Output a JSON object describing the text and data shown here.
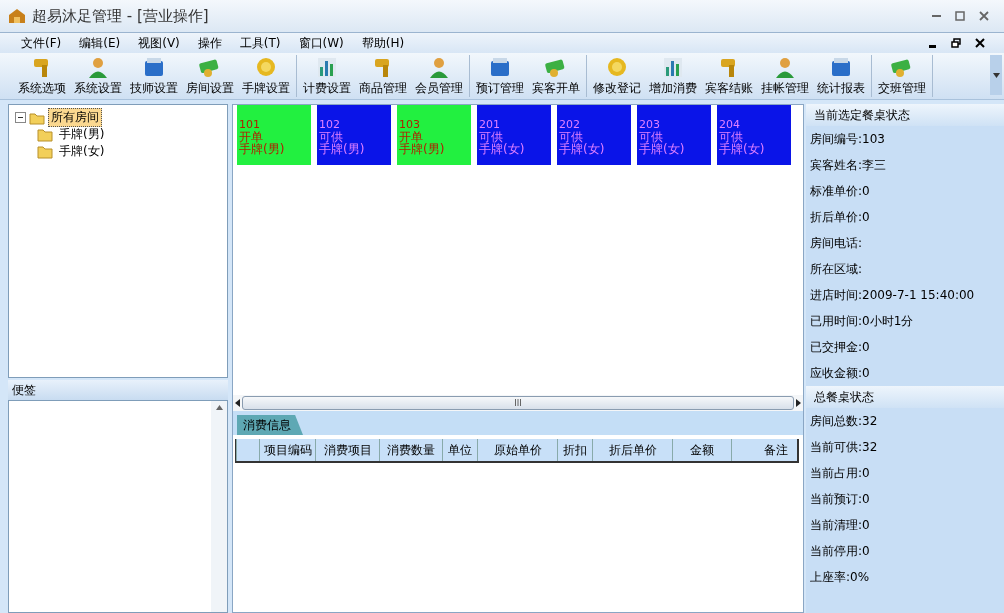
{
  "window": {
    "title": "超易沐足管理 - [营业操作]"
  },
  "menu": [
    "文件(F)",
    "编辑(E)",
    "视图(V)",
    "操作",
    "工具(T)",
    "窗口(W)",
    "帮助(H)"
  ],
  "toolbar_groups": [
    {
      "buttons": [
        "系统选项",
        "系统设置",
        "技师设置",
        "房间设置",
        "手牌设置"
      ]
    },
    {
      "buttons": [
        "计费设置",
        "商品管理",
        "会员管理"
      ]
    },
    {
      "buttons": [
        "预订管理",
        "宾客开单"
      ]
    },
    {
      "buttons": [
        "修改登记",
        "增加消费",
        "宾客结账",
        "挂帐管理",
        "统计报表"
      ]
    },
    {
      "buttons": [
        "交班管理"
      ]
    }
  ],
  "tree": [
    {
      "label": "所有房间",
      "selected": true,
      "expanded": true,
      "children": [
        {
          "label": "手牌(男)",
          "selected": false
        },
        {
          "label": "手牌(女)",
          "selected": false
        }
      ]
    }
  ],
  "notes": {
    "title": "便签"
  },
  "rooms": [
    {
      "number": "101",
      "status": "开单",
      "tag": "手牌(男)",
      "kind": "open"
    },
    {
      "number": "102",
      "status": "可供",
      "tag": "手牌(男)",
      "kind": "available"
    },
    {
      "number": "103",
      "status": "开单",
      "tag": "手牌(男)",
      "kind": "open"
    },
    {
      "number": "201",
      "status": "可供",
      "tag": "手牌(女)",
      "kind": "available"
    },
    {
      "number": "202",
      "status": "可供",
      "tag": "手牌(女)",
      "kind": "available"
    },
    {
      "number": "203",
      "status": "可供",
      "tag": "手牌(女)",
      "kind": "available"
    },
    {
      "number": "204",
      "status": "可供",
      "tag": "手牌(女)",
      "kind": "available"
    }
  ],
  "tabs": [
    {
      "label": "消费信息",
      "selected": true
    }
  ],
  "table": {
    "columns": [
      "项目编码",
      "消费项目",
      "消费数量",
      "单位",
      "原始单价",
      "折扣",
      "折后单价",
      "金额",
      "备注"
    ]
  },
  "info_sections": [
    {
      "title": "当前选定餐桌状态",
      "rows": [
        "房间编号:103",
        "宾客姓名:李三",
        "标准单价:0",
        "折后单价:0",
        "房间电话:",
        "所在区域:",
        "进店时间:2009-7-1 15:40:00",
        "已用时间:0小时1分",
        "已交押金:0",
        "应收金额:0"
      ]
    },
    {
      "title": "总餐桌状态",
      "rows": [
        "房间总数:32",
        "当前可供:32",
        "当前占用:0",
        "当前预订:0",
        "当前清理:0",
        "当前停用:0",
        "上座率:0%"
      ]
    }
  ]
}
